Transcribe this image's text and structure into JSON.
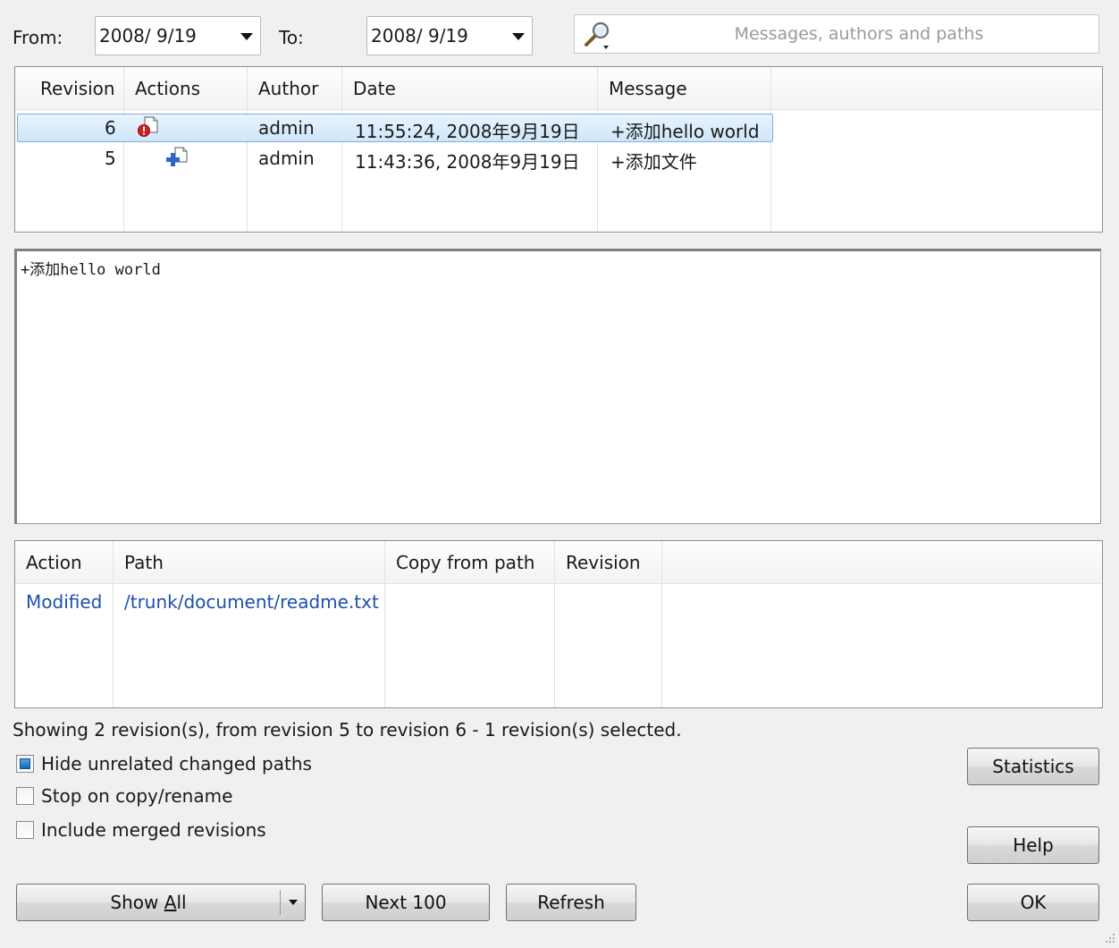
{
  "filter": {
    "from_label": "From:",
    "from_value": "2008/ 9/19",
    "to_label": "To:",
    "to_value": "2008/ 9/19",
    "search_placeholder": "Messages, authors and paths"
  },
  "log_table": {
    "columns": [
      "Revision",
      "Actions",
      "Author",
      "Date",
      "Message"
    ],
    "rows": [
      {
        "revision": "6",
        "action_icon": "modified-file-icon",
        "author": "admin",
        "date": "11:55:24, 2008年9月19日",
        "message": "+添加hello world",
        "selected": true
      },
      {
        "revision": "5",
        "action_icon": "added-file-icon",
        "author": "admin",
        "date": "11:43:36, 2008年9月19日",
        "message": "+添加文件",
        "selected": false
      }
    ]
  },
  "message_view": {
    "text": "+添加hello world"
  },
  "paths_table": {
    "columns": [
      "Action",
      "Path",
      "Copy from path",
      "Revision"
    ],
    "rows": [
      {
        "action": "Modified",
        "path": "/trunk/document/readme.txt",
        "copy_from": "",
        "revision": ""
      }
    ]
  },
  "status_text": "Showing 2 revision(s), from revision 5 to revision 6 - 1 revision(s) selected.",
  "options": [
    {
      "label": "Hide unrelated changed paths",
      "checked": true
    },
    {
      "label": "Stop on copy/rename",
      "checked": false
    },
    {
      "label": "Include merged revisions",
      "checked": false
    }
  ],
  "buttons": {
    "show_all_prefix": "Show ",
    "show_all_accel": "A",
    "show_all_suffix": "ll",
    "next_100": "Next 100",
    "refresh": "Refresh",
    "statistics": "Statistics",
    "help": "Help",
    "ok": "OK"
  },
  "colors": {
    "selection": "#cfe6fa",
    "link": "#1f4fae",
    "checked": "#1567b8"
  }
}
